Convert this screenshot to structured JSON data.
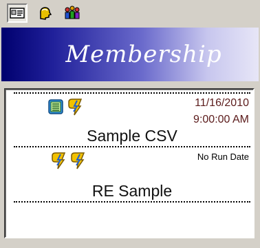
{
  "header": {
    "title": "Membership"
  },
  "toolbar": {
    "buttons": [
      {
        "name": "record-view",
        "icon": "id-card-icon",
        "pressed": true
      },
      {
        "name": "single-member",
        "icon": "person-head-icon",
        "pressed": false
      },
      {
        "name": "group-members",
        "icon": "group-people-icon",
        "pressed": false
      }
    ]
  },
  "items": [
    {
      "name": "Sample CSV",
      "date": "11/16/2010",
      "time": "9:00:00  AM",
      "icons": [
        "list-document-icon",
        "lightning-icon"
      ]
    },
    {
      "name": "RE Sample",
      "date": "No Run Date",
      "icons": [
        "lightning-icon",
        "lightning-icon"
      ]
    }
  ],
  "colors": {
    "header_dark": "#00006e",
    "header_light": "#e7e6f7",
    "window_bg": "#d4d0c8"
  }
}
